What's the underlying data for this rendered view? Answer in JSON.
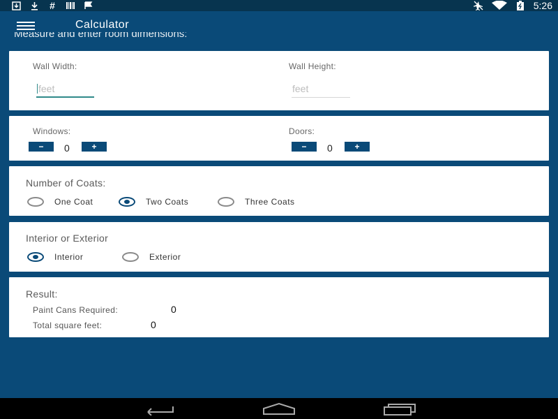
{
  "status_bar": {
    "left_icons": [
      "download-box-icon",
      "download-icon",
      "hashtag-icon",
      "barcode-icon",
      "flag-icon"
    ],
    "right_icons": [
      "airplane-icon",
      "wifi-icon",
      "battery-icon"
    ],
    "time": "5:26"
  },
  "app_bar": {
    "menu_icon": "hamburger-menu-icon",
    "title": "Calculator"
  },
  "instructions": "Measure and enter room dimensions:",
  "dimensions": {
    "wall_width_label": "Wall Width:",
    "wall_width_placeholder": "feet",
    "wall_height_label": "Wall Height:",
    "wall_height_placeholder": "feet"
  },
  "openings": {
    "windows_label": "Windows:",
    "windows_count": "0",
    "doors_label": "Doors:",
    "doors_count": "0",
    "minus": "−",
    "plus": "+"
  },
  "coats": {
    "heading": "Number of Coats:",
    "options": [
      "One Coat",
      "Two Coats",
      "Three Coats"
    ],
    "selected": "Two Coats"
  },
  "location": {
    "heading": "Interior or Exterior",
    "options": [
      "Interior",
      "Exterior"
    ],
    "selected": "Interior"
  },
  "result": {
    "heading": "Result:",
    "cans_label": "Paint Cans Required:",
    "cans_value": "0",
    "sqft_label": "Total square feet:",
    "sqft_value": "0"
  },
  "nav_bar": {
    "icons": [
      "back-icon",
      "home-icon",
      "recent-apps-icon"
    ]
  },
  "colors": {
    "primary": "#0a4a78",
    "status_bar": "#07344f",
    "accent": "#2f8a8a"
  }
}
